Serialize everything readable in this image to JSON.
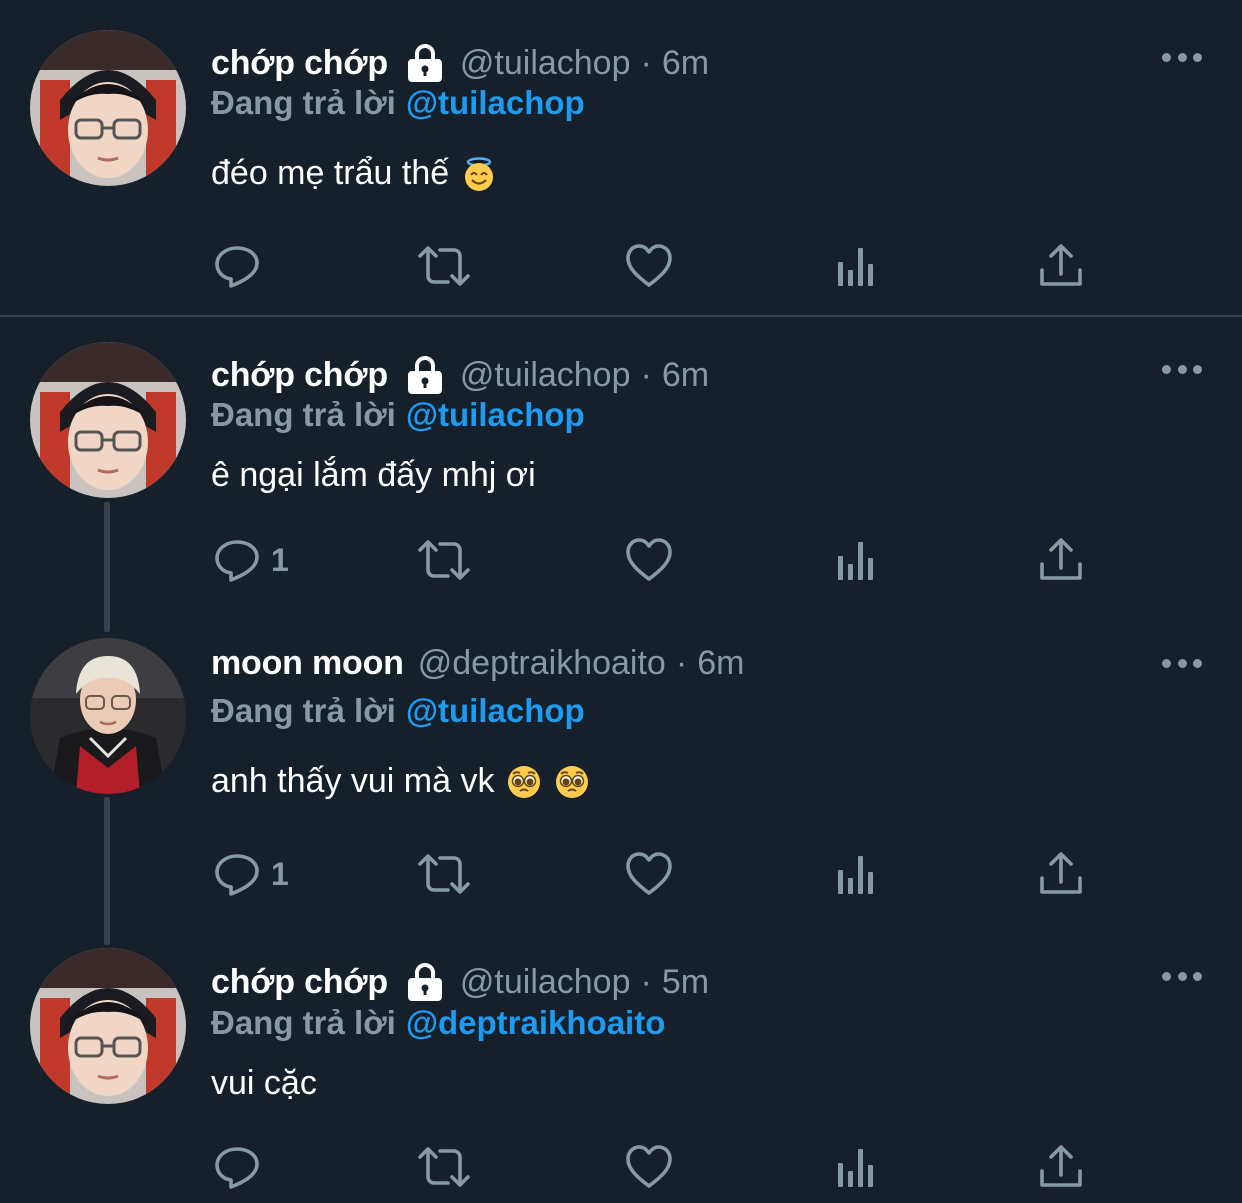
{
  "colors": {
    "background": "#15202b",
    "divider": "#38444d",
    "secondary_text": "#8899a6",
    "mention_blue": "#1d9bf0"
  },
  "tweets": [
    {
      "name": "chớp chớp",
      "protected": true,
      "handle": "@tuilachop",
      "separator": "·",
      "time": "6m",
      "reply_prefix": "Đang trả lời",
      "reply_to": "@tuilachop",
      "text": "đéo mẹ trẩu thế",
      "emojis": [
        "smiling-face-with-halo-emoji"
      ],
      "reply_count": "",
      "avatar": "avatar-chop"
    },
    {
      "name": "chớp chớp",
      "protected": true,
      "handle": "@tuilachop",
      "separator": "·",
      "time": "6m",
      "reply_prefix": "Đang trả lời",
      "reply_to": "@tuilachop",
      "text": "ê ngại lắm đấy mhj ơi",
      "emojis": [],
      "reply_count": "1",
      "avatar": "avatar-chop"
    },
    {
      "name": "moon moon",
      "protected": false,
      "handle": "@deptraikhoaito",
      "separator": "·",
      "time": "6m",
      "reply_prefix": "Đang trả lời",
      "reply_to": "@tuilachop",
      "text": "anh thấy vui mà vk",
      "emojis": [
        "pleading-face-emoji",
        "pleading-face-emoji"
      ],
      "reply_count": "1",
      "avatar": "avatar-moon"
    },
    {
      "name": "chớp chớp",
      "protected": true,
      "handle": "@tuilachop",
      "separator": "·",
      "time": "5m",
      "reply_prefix": "Đang trả lời",
      "reply_to": "@deptraikhoaito",
      "text": "vui cặc",
      "emojis": [],
      "reply_count": "",
      "avatar": "avatar-chop"
    }
  ],
  "action_icons": [
    "reply-icon",
    "retweet-icon",
    "like-icon",
    "analytics-icon",
    "share-icon"
  ]
}
